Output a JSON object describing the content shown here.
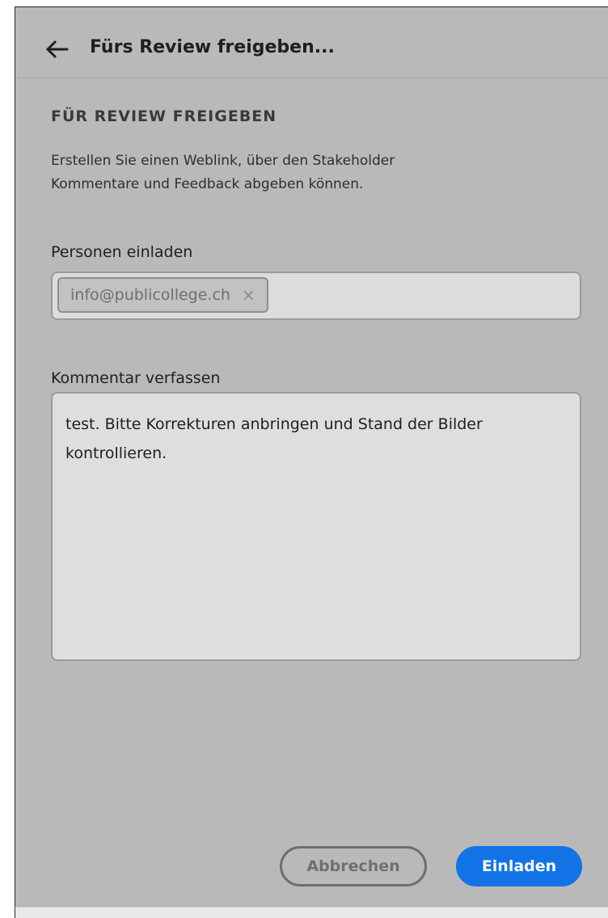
{
  "header": {
    "back_icon": "arrow-left-icon",
    "title": "Fürs Review freigeben..."
  },
  "section": {
    "heading": "FÜR REVIEW FREIGEBEN",
    "description_line1": "Erstellen Sie einen Weblink, über den Stakeholder",
    "description_line2": "Kommentare und Feedback abgeben können."
  },
  "invite": {
    "label": "Personen einladen",
    "chips": [
      {
        "text": "info@publicollege.ch",
        "remove_icon": "×"
      }
    ]
  },
  "comment": {
    "label": "Kommentar verfassen",
    "value": "test. Bitte Korrekturen anbringen und Stand der Bilder kontrollieren."
  },
  "buttons": {
    "cancel": "Abbrechen",
    "invite": "Einladen"
  },
  "colors": {
    "panel_bg": "#b9b9b9",
    "accent": "#1273e6"
  }
}
